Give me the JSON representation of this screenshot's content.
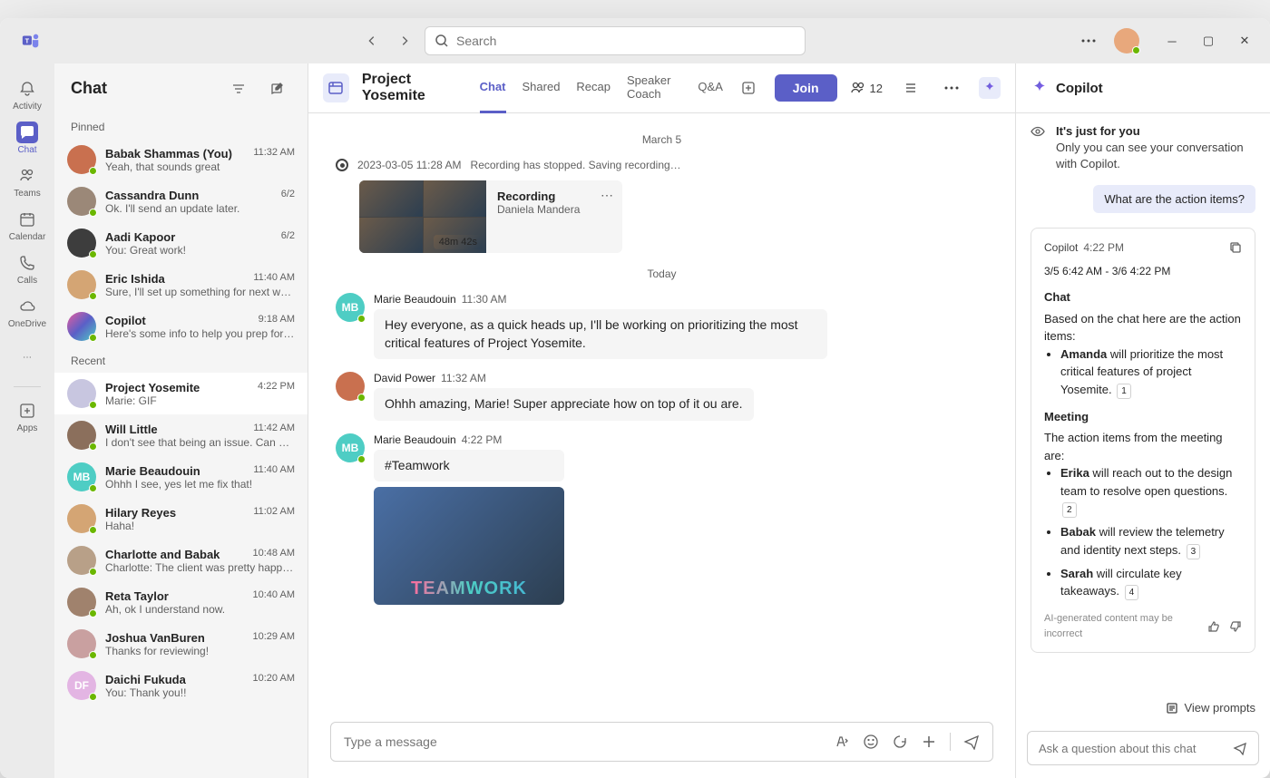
{
  "search_placeholder": "Search",
  "rail": [
    {
      "label": "Activity",
      "icon": "bell"
    },
    {
      "label": "Chat",
      "icon": "chat",
      "active": true
    },
    {
      "label": "Teams",
      "icon": "teams"
    },
    {
      "label": "Calendar",
      "icon": "calendar"
    },
    {
      "label": "Calls",
      "icon": "calls"
    },
    {
      "label": "OneDrive",
      "icon": "cloud"
    }
  ],
  "rail_apps": "Apps",
  "list": {
    "title": "Chat",
    "pinned_label": "Pinned",
    "recent_label": "Recent",
    "pinned": [
      {
        "name": "Babak Shammas (You)",
        "preview": "Yeah, that sounds great",
        "time": "11:32 AM",
        "color": "#c9704f"
      },
      {
        "name": "Cassandra Dunn",
        "preview": "Ok. I'll send an update later.",
        "time": "6/2",
        "color": "#9b8878"
      },
      {
        "name": "Aadi Kapoor",
        "preview": "You: Great work!",
        "time": "6/2",
        "color": "#3d3d3d"
      },
      {
        "name": "Eric Ishida",
        "preview": "Sure, I'll set up something for next week t…",
        "time": "11:40 AM",
        "color": "#d4a574"
      },
      {
        "name": "Copilot",
        "preview": "Here's some info to help you prep for your…",
        "time": "9:18 AM",
        "color": "gradient"
      }
    ],
    "recent": [
      {
        "name": "Project Yosemite",
        "preview": "Marie: GIF",
        "time": "4:22 PM",
        "color": "#c8c6e0",
        "initials": "",
        "selected": true
      },
      {
        "name": "Will Little",
        "preview": "I don't see that being an issue. Can you ta…",
        "time": "11:42 AM",
        "color": "#8b6f5c"
      },
      {
        "name": "Marie Beaudouin",
        "preview": "Ohhh I see, yes let me fix that!",
        "time": "11:40 AM",
        "color": "#4ecdc4",
        "initials": "MB"
      },
      {
        "name": "Hilary Reyes",
        "preview": "Haha!",
        "time": "11:02 AM",
        "color": "#d4a574"
      },
      {
        "name": "Charlotte and Babak",
        "preview": "Charlotte: The client was pretty happy with…",
        "time": "10:48 AM",
        "color": "#b8a088"
      },
      {
        "name": "Reta Taylor",
        "preview": "Ah, ok I understand now.",
        "time": "10:40 AM",
        "color": "#a0826d"
      },
      {
        "name": "Joshua VanBuren",
        "preview": "Thanks for reviewing!",
        "time": "10:29 AM",
        "color": "#c9a0a0"
      },
      {
        "name": "Daichi Fukuda",
        "preview": "You: Thank you!!",
        "time": "10:20 AM",
        "color": "#e3b5e3",
        "initials": "DF"
      }
    ]
  },
  "conv": {
    "title": "Project Yosemite",
    "tabs": [
      "Chat",
      "Shared",
      "Recap",
      "Speaker Coach",
      "Q&A"
    ],
    "join": "Join",
    "participants": "12",
    "date1": "March 5",
    "sys_time": "2023-03-05 11:28 AM",
    "sys_text": "Recording has stopped. Saving recording…",
    "recording": {
      "title": "Recording",
      "author": "Daniela Mandera",
      "duration": "48m 42s"
    },
    "date2": "Today",
    "messages": [
      {
        "author": "Marie Beaudouin",
        "time": "11:30 AM",
        "initials": "MB",
        "color": "#4ecdc4",
        "text": "Hey everyone, as a quick heads up, I'll be working on prioritizing the most critical features of Project Yosemite."
      },
      {
        "author": "David Power",
        "time": "11:32 AM",
        "initials": "",
        "color": "#c9704f",
        "text": "Ohhh amazing, Marie! Super appreciate how on top of it ou are."
      },
      {
        "author": "Marie Beaudouin",
        "time": "4:22 PM",
        "initials": "MB",
        "color": "#4ecdc4",
        "text": "#Teamwork",
        "gif": true,
        "gif_text": "TEAMWORK"
      }
    ],
    "composer_placeholder": "Type a message"
  },
  "copilot": {
    "title": "Copilot",
    "info_title": "It's just for you",
    "info_text": "Only you can see your conversation with Copilot.",
    "user_msg": "What are the action items?",
    "resp_name": "Copilot",
    "resp_time": "4:22 PM",
    "range": "3/5 6:42 AM - 3/6 4:22 PM",
    "chat_heading": "Chat",
    "chat_intro": "Based on the chat here are the action items:",
    "chat_items": [
      {
        "bold": "Amanda",
        "rest": " will prioritize the most critical features of project Yosemite.",
        "cite": "1"
      }
    ],
    "meeting_heading": "Meeting",
    "meeting_intro": "The action items from the meeting are:",
    "meeting_items": [
      {
        "bold": "Erika",
        "rest": " will reach out to the design team to resolve open questions.",
        "cite": "2"
      },
      {
        "bold": "Babak",
        "rest": " will review the telemetry and identity next steps.",
        "cite": "3"
      },
      {
        "bold": "Sarah",
        "rest": " will circulate key takeaways.",
        "cite": "4"
      }
    ],
    "disclaimer": "AI-generated content may be incorrect",
    "prompts": "View prompts",
    "input_placeholder": "Ask a question about this chat"
  }
}
